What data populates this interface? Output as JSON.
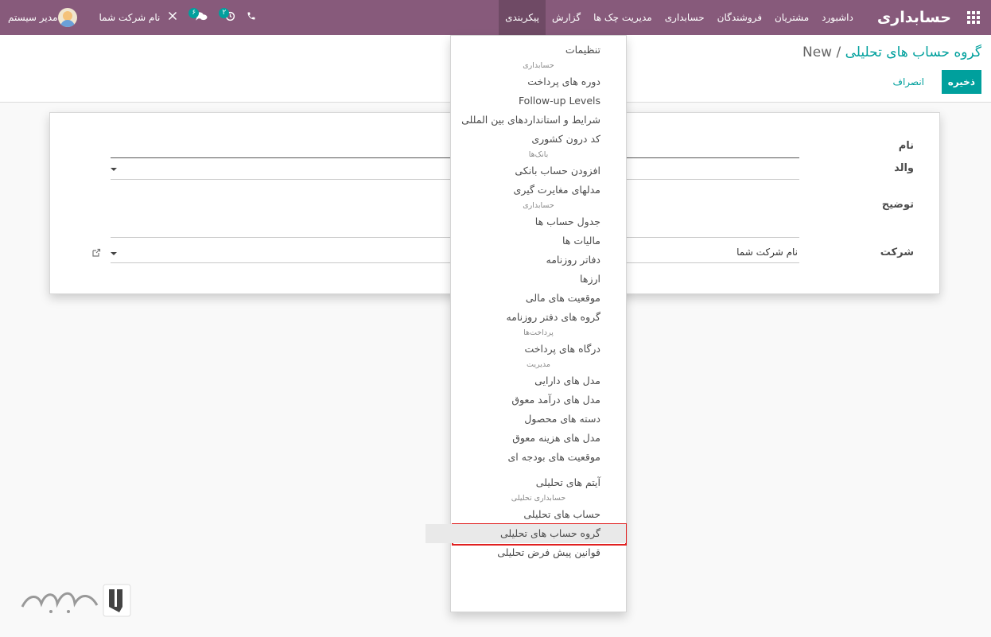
{
  "navbar": {
    "brand": "حسابداری",
    "menus": [
      "داشبورد",
      "مشتریان",
      "فروشندگان",
      "حسابداری",
      "مدیریت چک ها",
      "گزارش",
      "پیکربندی"
    ],
    "open_menu": "پیکربندی",
    "activity_count": "۲",
    "messages_count": "۶",
    "company": "نام شرکت شما",
    "user": "مدیر سیستم"
  },
  "control_panel": {
    "breadcrumb_parent": "گروه حساب های تحلیلی",
    "breadcrumb_separator": "/",
    "breadcrumb_current": "New",
    "save_label": "ذخیره",
    "discard_label": "انصراف"
  },
  "form": {
    "name_label": "نام",
    "parent_label": "والد",
    "description_label": "توضیح",
    "company_label": "شرکت",
    "company_value": "نام شرکت شما"
  },
  "dropdown": {
    "items": [
      {
        "type": "item",
        "label": "تنظیمات"
      },
      {
        "type": "header",
        "label": "حسابداری"
      },
      {
        "type": "item",
        "label": "دوره های پرداخت"
      },
      {
        "type": "item",
        "label": "Follow-up Levels"
      },
      {
        "type": "item",
        "label": "شرایط و استانداردهای بین المللی"
      },
      {
        "type": "item",
        "label": "کد درون کشوری"
      },
      {
        "type": "header",
        "label": "بانک‌ها"
      },
      {
        "type": "item",
        "label": "افزودن حساب بانکی"
      },
      {
        "type": "item",
        "label": "مدلهای مغایرت گیری"
      },
      {
        "type": "header",
        "label": "حسابداری"
      },
      {
        "type": "item",
        "label": "جدول حساب ها"
      },
      {
        "type": "item",
        "label": "مالیات ها"
      },
      {
        "type": "item",
        "label": "دفاتر روزنامه"
      },
      {
        "type": "item",
        "label": "ارزها"
      },
      {
        "type": "item",
        "label": "موقعیت های مالی"
      },
      {
        "type": "item",
        "label": "گروه های دفتر روزنامه"
      },
      {
        "type": "header",
        "label": "پرداخت‌ها"
      },
      {
        "type": "item",
        "label": "درگاه های پرداخت"
      },
      {
        "type": "header",
        "label": "مدیریت"
      },
      {
        "type": "item",
        "label": "مدل های دارایی"
      },
      {
        "type": "item",
        "label": "مدل های درآمد معوق"
      },
      {
        "type": "item",
        "label": "دسته های محصول"
      },
      {
        "type": "item",
        "label": "مدل های هزینه معوق"
      },
      {
        "type": "item",
        "label": "موقعیت های بودجه ای"
      },
      {
        "type": "item",
        "label": "آیتم های تحلیلی"
      },
      {
        "type": "header",
        "label": "حسابداری تحلیلی"
      },
      {
        "type": "item",
        "label": "حساب های تحلیلی"
      },
      {
        "type": "item",
        "label": "گروه حساب های تحلیلی",
        "selected": true
      },
      {
        "type": "item",
        "label": "قوانین پیش فرض تحلیلی"
      }
    ]
  },
  "colors": {
    "navbar": "#875a7b",
    "accent": "#00a09d",
    "highlight": "#e02020"
  }
}
